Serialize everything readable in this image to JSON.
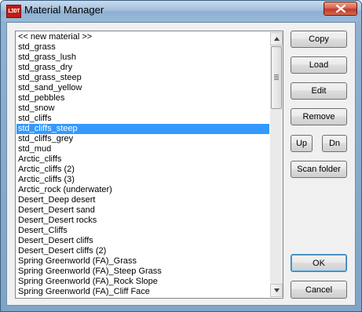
{
  "window": {
    "title": "Material Manager"
  },
  "materials": [
    "<< new material >>",
    "std_grass",
    "std_grass_lush",
    "std_grass_dry",
    "std_grass_steep",
    "std_sand_yellow",
    "std_pebbles",
    "std_snow",
    "std_cliffs",
    "std_cliffs_steep",
    "std_cliffs_grey",
    "std_mud",
    "Arctic_cliffs",
    "Arctic_cliffs (2)",
    "Arctic_cliffs (3)",
    "Arctic_rock (underwater)",
    "Desert_Deep desert",
    "Desert_Desert sand",
    "Desert_Desert rocks",
    "Desert_Cliffs",
    "Desert_Desert cliffs",
    "Desert_Desert cliffs (2)",
    "Spring Greenworld (FA)_Grass",
    "Spring Greenworld (FA)_Steep Grass",
    "Spring Greenworld (FA)_Rock Slope",
    "Spring Greenworld (FA)_Cliff Face"
  ],
  "selected_material": "std_cliffs_steep",
  "buttons": {
    "copy": "Copy",
    "load": "Load",
    "edit": "Edit",
    "remove": "Remove",
    "up": "Up",
    "down": "Dn",
    "scan_folder": "Scan folder",
    "ok": "OK",
    "cancel": "Cancel"
  },
  "icons": {
    "app": "app-logo-icon",
    "close": "close-icon",
    "scroll_up": "scroll-up-arrow-icon",
    "scroll_down": "scroll-down-arrow-icon"
  },
  "app_icon_text": "L3DT",
  "colors": {
    "selection": "#3399ff",
    "close_button": "#c0392b",
    "title_bar": "#a4c0dc"
  }
}
